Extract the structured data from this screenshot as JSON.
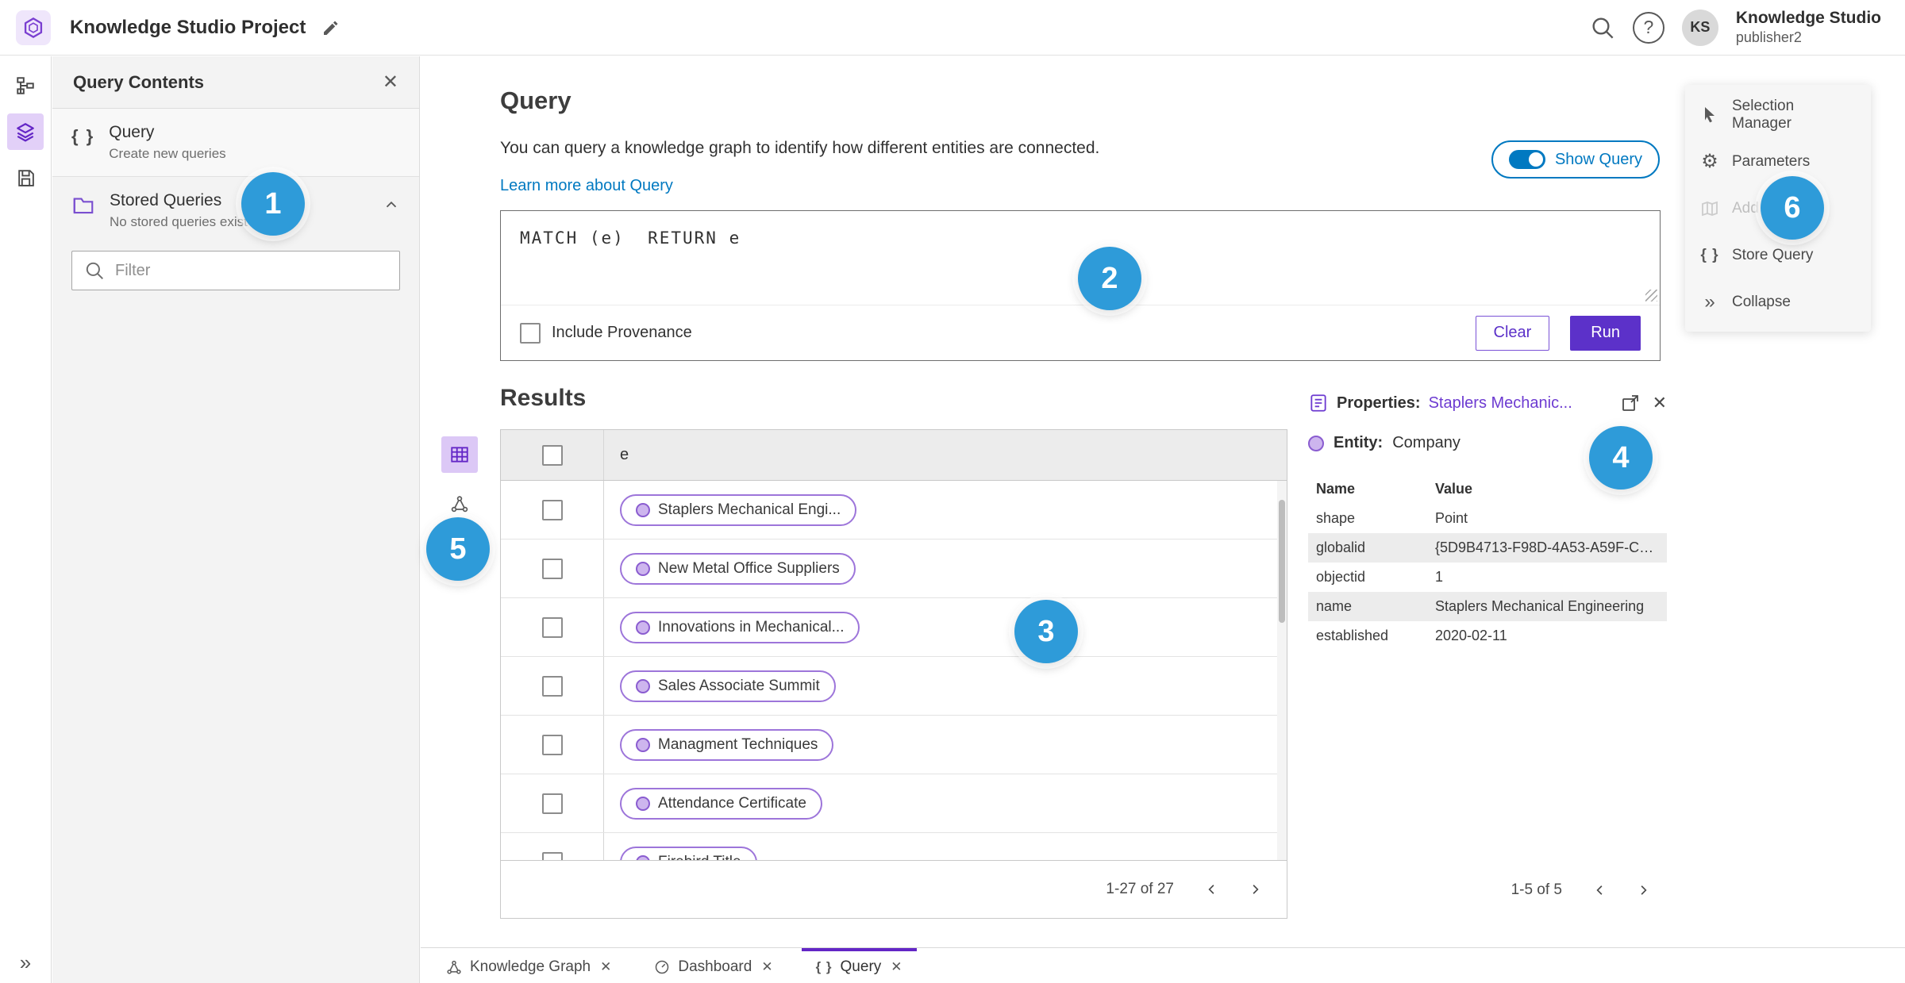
{
  "topbar": {
    "title": "Knowledge Studio Project",
    "user_name": "Knowledge Studio",
    "user_role": "publisher2",
    "avatar_initials": "KS"
  },
  "left_panel": {
    "title": "Query Contents",
    "query_item": {
      "label": "Query",
      "sublabel": "Create new queries"
    },
    "stored_item": {
      "label": "Stored Queries",
      "sublabel": "No stored queries exist"
    },
    "filter_placeholder": "Filter"
  },
  "query_section": {
    "title": "Query",
    "description": "You can query a knowledge graph to identify how different entities are connected.",
    "learn_more": "Learn more about Query",
    "show_query": "Show Query",
    "editor_text": "MATCH (e)  RETURN e",
    "include_provenance": "Include Provenance",
    "clear": "Clear",
    "run": "Run"
  },
  "results": {
    "title": "Results",
    "column": "e",
    "rows": [
      "Staplers Mechanical Engi...",
      "New Metal Office Suppliers",
      "Innovations in Mechanical...",
      "Sales Associate Summit",
      "Managment Techniques",
      "Attendance Certificate",
      "Firebird Title"
    ],
    "pagination": "1-27 of 27"
  },
  "properties": {
    "label": "Properties:",
    "link": "Staplers Mechanic...",
    "entity_label": "Entity:",
    "entity_value": "Company",
    "col_name": "Name",
    "col_value": "Value",
    "rows": [
      {
        "name": "shape",
        "value": "Point"
      },
      {
        "name": "globalid",
        "value": "{5D9B4713-F98D-4A53-A59F-C11..."
      },
      {
        "name": "objectid",
        "value": "1"
      },
      {
        "name": "name",
        "value": "Staplers Mechanical Engineering"
      },
      {
        "name": "established",
        "value": "2020-02-11"
      }
    ],
    "pagination": "1-5 of 5"
  },
  "tools": {
    "items": [
      "Selection Manager",
      "Parameters",
      "Add To Map",
      "Store Query",
      "Collapse"
    ]
  },
  "tabs": [
    {
      "label": "Knowledge Graph"
    },
    {
      "label": "Dashboard"
    },
    {
      "label": "Query"
    }
  ],
  "annotations": [
    "1",
    "2",
    "3",
    "4",
    "5",
    "6"
  ],
  "colors": {
    "accent_purple": "#6326c6",
    "run_purple": "#5c31c9",
    "link_blue": "#0079c1",
    "badge_blue": "#2e9bd9"
  }
}
